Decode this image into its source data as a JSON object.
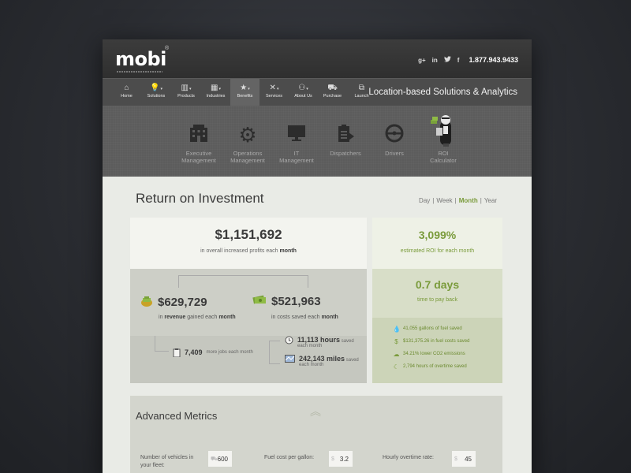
{
  "header": {
    "logo_text": "mobi",
    "logo_reg": "®",
    "social": [
      "g+",
      "in",
      "t",
      "f"
    ],
    "phone": "1.877.943.9433"
  },
  "nav": {
    "items": [
      {
        "label": "Home",
        "icon": "home-icon"
      },
      {
        "label": "Solutions",
        "icon": "lightbulb-icon",
        "dropdown": true
      },
      {
        "label": "Products",
        "icon": "chart-icon",
        "dropdown": true
      },
      {
        "label": "Industries",
        "icon": "building-icon",
        "dropdown": true
      },
      {
        "label": "Benefits",
        "icon": "star-icon",
        "dropdown": true,
        "active": true
      },
      {
        "label": "Services",
        "icon": "tools-icon",
        "dropdown": true
      },
      {
        "label": "About Us",
        "icon": "people-icon",
        "dropdown": true
      },
      {
        "label": "Purchase",
        "icon": "cart-icon"
      },
      {
        "label": "Launch",
        "icon": "launch-icon"
      }
    ],
    "tagline": "Location-based Solutions & Analytics"
  },
  "subnav": {
    "items": [
      {
        "label1": "Executive",
        "label2": "Management",
        "icon": "building-icon"
      },
      {
        "label1": "Operations",
        "label2": "Management",
        "icon": "gear-icon"
      },
      {
        "label1": "IT",
        "label2": "Management",
        "icon": "monitor-icon"
      },
      {
        "label1": "Dispatchers",
        "label2": "",
        "icon": "clipboard-icon"
      },
      {
        "label1": "Drivers",
        "label2": "",
        "icon": "steering-wheel-icon"
      },
      {
        "label1": "ROI",
        "label2": "Calculator",
        "icon": "roi-person-icon",
        "active": true
      }
    ]
  },
  "roi": {
    "title": "Return on Investment",
    "periods": [
      "Day",
      "Week",
      "Month",
      "Year"
    ],
    "selected_period": "Month",
    "total_value": "$1,151,692",
    "total_label_pre": "in overall increased profits each ",
    "total_label_bold": "month",
    "revenue_value": "$629,729",
    "revenue_label_pre": "in ",
    "revenue_label_bold": "revenue",
    "revenue_label_mid": " gained each ",
    "revenue_label_end": "month",
    "costs_value": "$521,963",
    "costs_label_pre": "in costs saved each ",
    "costs_label_bold": "month",
    "jobs_value": "7,409",
    "jobs_label": "more jobs each month",
    "hours_value": "11,113 hours",
    "hours_label1": "saved",
    "hours_label2": "each month",
    "miles_value": "242,143 miles",
    "miles_label1": "saved",
    "miles_label2": "each month",
    "roi_pct": "3,099%",
    "roi_label": "estimated ROI for each month",
    "payback_value": "0.7 days",
    "payback_label": "time to pay back",
    "stats": [
      {
        "icon": "fuel-drop-icon",
        "value": "41,055",
        "text": "gallons of fuel saved"
      },
      {
        "icon": "dollar-icon",
        "value": "$131,375.26",
        "text": "in fuel costs saved"
      },
      {
        "icon": "cloud-icon",
        "value": "34.21%",
        "text": "lower CO2 emissions"
      },
      {
        "icon": "moon-icon",
        "value": "2,794",
        "text": "hours of overtime saved"
      }
    ]
  },
  "advanced": {
    "title": "Advanced Metrics",
    "fields": [
      {
        "label1": "Number of vehicles in",
        "label2": "your fleet:",
        "value": "600"
      },
      {
        "label1": "Fuel cost per gallon:",
        "label2": "",
        "prefix": "$",
        "value": "3.2"
      },
      {
        "label1": "Hourly overtime rate:",
        "label2": "",
        "prefix": "$",
        "value": "45"
      }
    ]
  }
}
